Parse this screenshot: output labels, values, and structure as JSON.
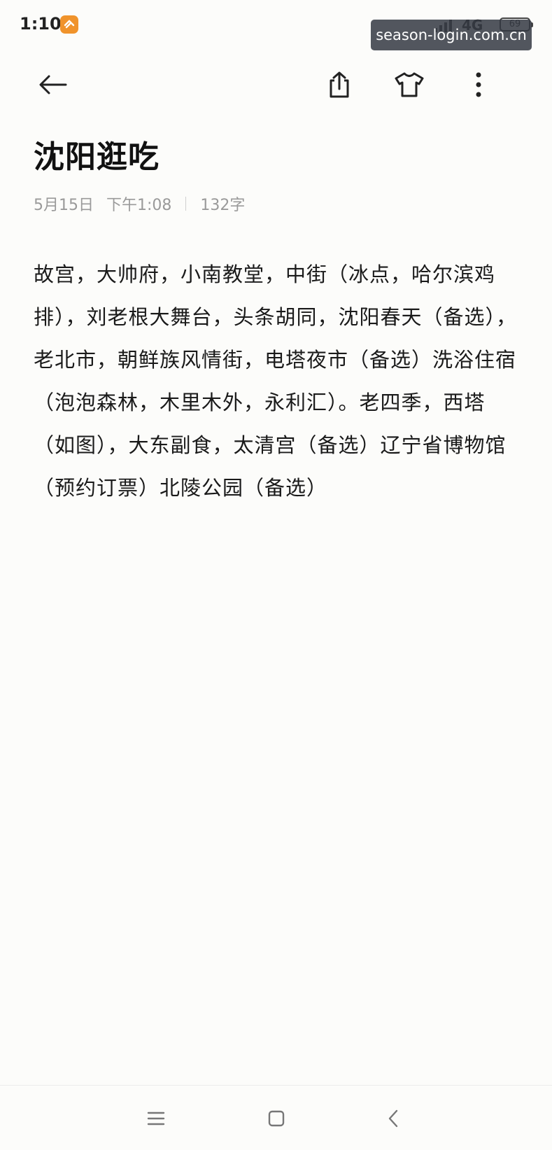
{
  "status_bar": {
    "time": "1:10",
    "network": "4G",
    "battery": "69",
    "app_badge_icon": "app-notification-icon",
    "signal_icon": "signal-icon"
  },
  "watermark": "season-login.com.cn",
  "toolbar": {
    "back_icon": "back-arrow-icon",
    "share_icon": "share-icon",
    "theme_icon": "tshirt-theme-icon",
    "more_icon": "more-vertical-icon"
  },
  "note": {
    "title": "沈阳逛吃",
    "date": "5月15日",
    "time": "下午1:08",
    "char_count": "132字",
    "content": "故宫，大帅府，小南教堂，中街（冰点，哈尔滨鸡排），刘老根大舞台，头条胡同，沈阳春天（备选），老北市，朝鲜族风情街，电塔夜市（备选）洗浴住宿（泡泡森林，木里木外，永利汇）。老四季，西塔（如图），大东副食，太清宫（备选）辽宁省博物馆（预约订票）北陵公园（备选）"
  },
  "nav_bar": {
    "menu_icon": "menu-icon",
    "home_icon": "home-square-icon",
    "back_icon": "nav-back-icon"
  },
  "colors": {
    "background": "#fcfcfa",
    "text": "#111111",
    "meta_text": "#9a9a9a",
    "badge": "#f0932b"
  }
}
